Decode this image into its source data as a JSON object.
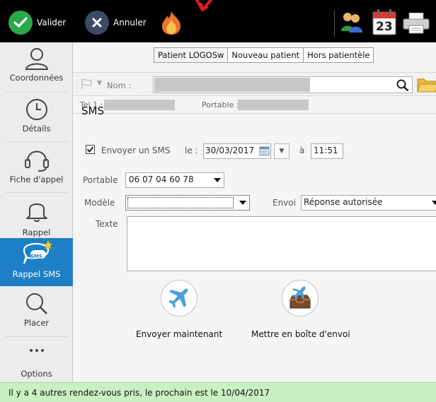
{
  "toolbar": {
    "valider_label": "Valider",
    "annuler_label": "Annuler",
    "icons": [
      "check-icon",
      "cancel-icon",
      "fire-icon",
      "users-icon",
      "calendar-icon",
      "printer-icon"
    ],
    "calendar_day": "23"
  },
  "sidebar": {
    "items": [
      {
        "label": "Coordonnées",
        "icon": "person-icon"
      },
      {
        "label": "Détails",
        "icon": "clock-icon"
      },
      {
        "label": "Fiche d'appel",
        "icon": "headset-icon"
      },
      {
        "label": "Rappel",
        "icon": "bell-icon"
      },
      {
        "label": "Rappel SMS",
        "icon": "sms-bubble-icon",
        "active": true
      },
      {
        "label": "Placer",
        "icon": "magnifier-icon"
      },
      {
        "label": "Options",
        "icon": "more-icon"
      }
    ],
    "sms_badge": "SMS"
  },
  "tabs": [
    "Patient LOGOSw",
    "Nouveau patient",
    "Hors patientèle"
  ],
  "patient": {
    "nom_label": "Nom :",
    "tel_label": "Tel 1 : 04",
    "portable_label": "Portable : 06"
  },
  "sms": {
    "title": "SMS",
    "envoyer_label": "Envoyer un SMS",
    "le_label": "le :",
    "date": "30/03/2017",
    "a_label": "à",
    "time": "11:51",
    "portable_label": "Portable",
    "portable_value": "06 07 04 60 78",
    "modele_label": "Modèle",
    "modele_value": "",
    "envoi_label": "Envoi",
    "envoi_value": "Réponse autorisée",
    "texte_label": "Texte",
    "texte_value": ""
  },
  "actions": {
    "send_now_label": "Envoyer maintenant",
    "outbox_label": "Mettre en boîte d'envoi"
  },
  "status": {
    "text": "Il y a 4 autres rendez-vous pris, le prochain est le 10/04/2017"
  },
  "colors": {
    "accent": "#1e7fc6",
    "status_bg": "#c9f0c2",
    "valider_green": "#2aa84a"
  }
}
